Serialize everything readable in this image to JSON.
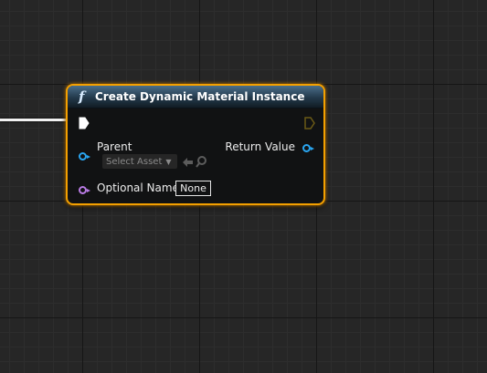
{
  "node": {
    "title": "Create Dynamic Material Instance",
    "icon": "function-icon",
    "pins": {
      "exec_in": "exec-input-pin",
      "exec_out": "exec-output-pin",
      "parent_label": "Parent",
      "return_label": "Return Value",
      "optional_name_label": "Optional Name"
    },
    "parent_asset_select": "Select Asset",
    "optional_name_value": "None"
  },
  "colors": {
    "node_border": "#f4a000",
    "object_pin": "#2aa6f1",
    "name_pin": "#b97be4",
    "header": "#4b6f8a"
  }
}
